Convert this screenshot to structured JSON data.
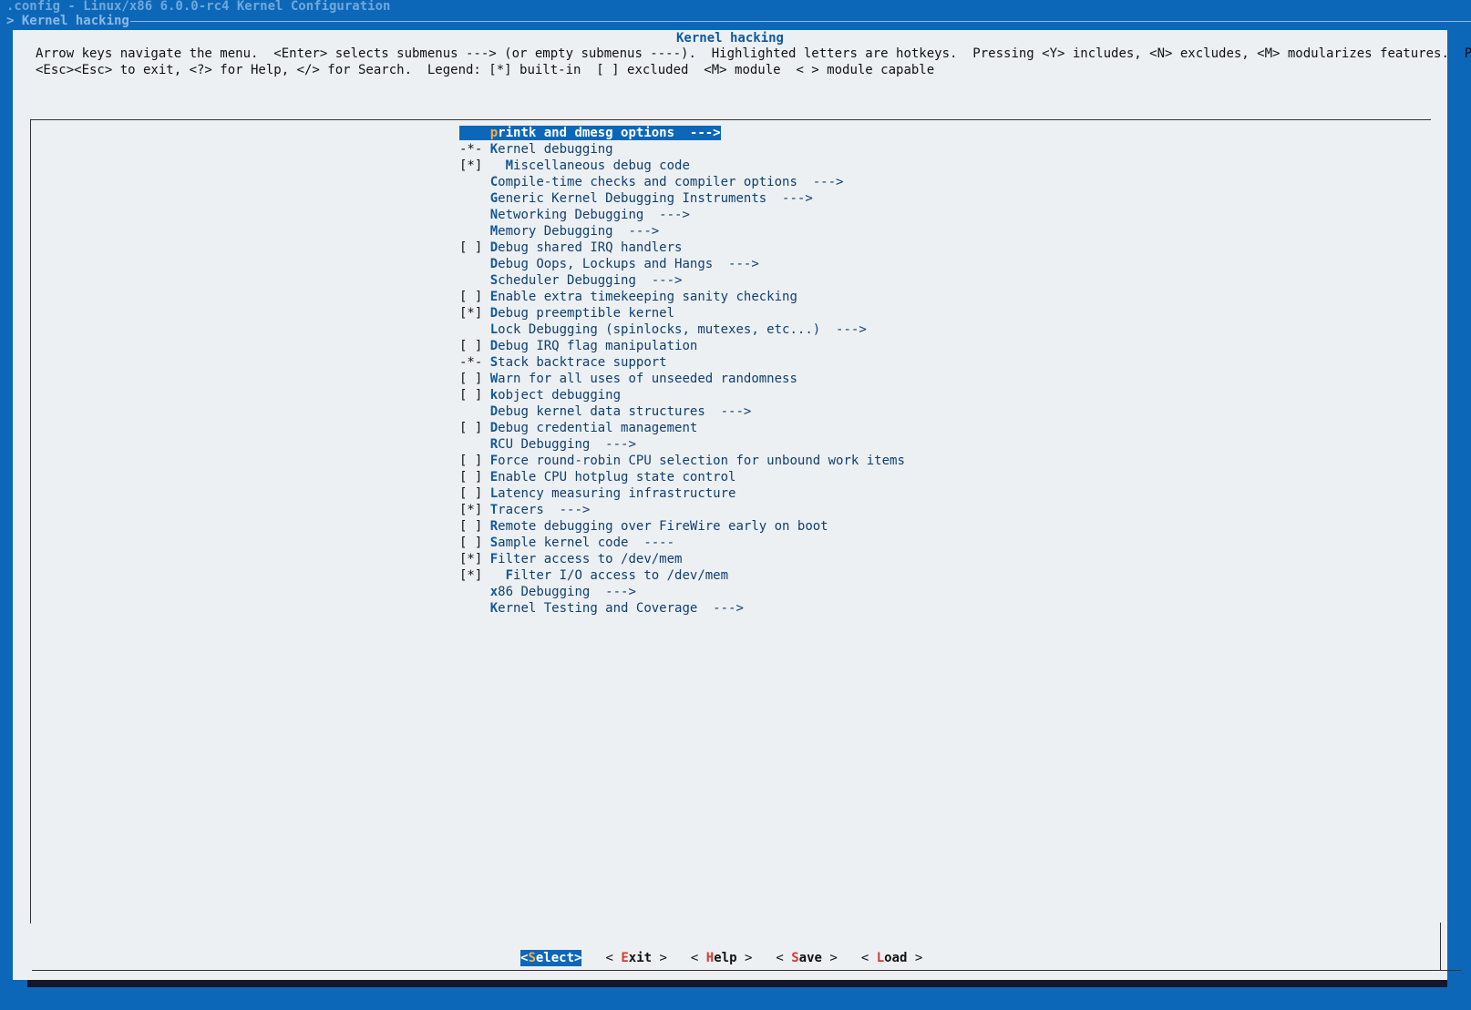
{
  "window": {
    "title": ".config - Linux/x86 6.0.0-rc4 Kernel Configuration",
    "breadcrumb": "> Kernel hacking"
  },
  "dialog": {
    "title": "Kernel hacking",
    "help_line_1": "Arrow keys navigate the menu.  <Enter> selects submenus ---> (or empty submenus ----).  Highlighted letters are hotkeys.  Pressing <Y> includes, <N> excludes, <M> modularizes features.  Press",
    "help_line_2": "<Esc><Esc> to exit, <?> for Help, </> for Search.  Legend: [*] built-in  [ ] excluded  <M> module  < > module capable"
  },
  "menu": {
    "items": [
      {
        "mark": "   ",
        "indent": "",
        "label": "printk and dmesg options  --->",
        "selected": true
      },
      {
        "mark": "-*-",
        "indent": "",
        "label": "Kernel debugging"
      },
      {
        "mark": "[*]",
        "indent": "  ",
        "label": "Miscellaneous debug code"
      },
      {
        "mark": "   ",
        "indent": "",
        "label": "Compile-time checks and compiler options  --->"
      },
      {
        "mark": "   ",
        "indent": "",
        "label": "Generic Kernel Debugging Instruments  --->"
      },
      {
        "mark": "   ",
        "indent": "",
        "label": "Networking Debugging  --->"
      },
      {
        "mark": "   ",
        "indent": "",
        "label": "Memory Debugging  --->"
      },
      {
        "mark": "[ ]",
        "indent": "",
        "label": "Debug shared IRQ handlers"
      },
      {
        "mark": "   ",
        "indent": "",
        "label": "Debug Oops, Lockups and Hangs  --->"
      },
      {
        "mark": "   ",
        "indent": "",
        "label": "Scheduler Debugging  --->"
      },
      {
        "mark": "[ ]",
        "indent": "",
        "label": "Enable extra timekeeping sanity checking"
      },
      {
        "mark": "[*]",
        "indent": "",
        "label": "Debug preemptible kernel"
      },
      {
        "mark": "   ",
        "indent": "",
        "label": "Lock Debugging (spinlocks, mutexes, etc...)  --->"
      },
      {
        "mark": "[ ]",
        "indent": "",
        "label": "Debug IRQ flag manipulation"
      },
      {
        "mark": "-*-",
        "indent": "",
        "label": "Stack backtrace support"
      },
      {
        "mark": "[ ]",
        "indent": "",
        "label": "Warn for all uses of unseeded randomness"
      },
      {
        "mark": "[ ]",
        "indent": "",
        "label": "kobject debugging"
      },
      {
        "mark": "   ",
        "indent": "",
        "label": "Debug kernel data structures  --->"
      },
      {
        "mark": "[ ]",
        "indent": "",
        "label": "Debug credential management"
      },
      {
        "mark": "   ",
        "indent": "",
        "label": "RCU Debugging  --->"
      },
      {
        "mark": "[ ]",
        "indent": "",
        "label": "Force round-robin CPU selection for unbound work items"
      },
      {
        "mark": "[ ]",
        "indent": "",
        "label": "Enable CPU hotplug state control"
      },
      {
        "mark": "[ ]",
        "indent": "",
        "label": "Latency measuring infrastructure"
      },
      {
        "mark": "[*]",
        "indent": "",
        "label": "Tracers  --->"
      },
      {
        "mark": "[ ]",
        "indent": "",
        "label": "Remote debugging over FireWire early on boot"
      },
      {
        "mark": "[ ]",
        "indent": "",
        "label": "Sample kernel code  ----"
      },
      {
        "mark": "[*]",
        "indent": "",
        "label": "Filter access to /dev/mem"
      },
      {
        "mark": "[*]",
        "indent": "  ",
        "label": "Filter I/O access to /dev/mem"
      },
      {
        "mark": "   ",
        "indent": "",
        "label": "x86 Debugging  --->"
      },
      {
        "mark": "   ",
        "indent": "",
        "label": "Kernel Testing and Coverage  --->"
      }
    ]
  },
  "buttons": [
    {
      "name": "select-button",
      "pre": "<",
      "hotkey": "S",
      "rest": "elect",
      "post": ">",
      "active": true
    },
    {
      "name": "exit-button",
      "pre": "< ",
      "hotkey": "E",
      "rest": "xit",
      "post": " >"
    },
    {
      "name": "help-button",
      "pre": "< ",
      "hotkey": "H",
      "rest": "elp",
      "post": " >"
    },
    {
      "name": "save-button",
      "pre": "< ",
      "hotkey": "S",
      "rest": "ave",
      "post": " >"
    },
    {
      "name": "load-button",
      "pre": "< ",
      "hotkey": "L",
      "rest": "oad",
      "post": " >"
    }
  ],
  "colors": {
    "terminal_bg": "#0c67b8",
    "dialog_bg": "#edf0f2",
    "selection_bg": "#0c67b8",
    "hotkey_blue": "#0e5a9f",
    "hotkey_red": "#d43b30",
    "hotkey_selected": "#f0b048"
  }
}
